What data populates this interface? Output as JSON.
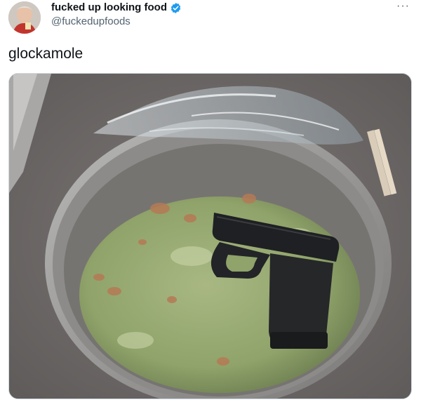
{
  "tweet": {
    "display_name": "fucked up looking food",
    "handle": "@fuckedupfoods",
    "text": "glockamole",
    "more_icon": "more-icon",
    "verified_icon": "verified-badge-icon",
    "colors": {
      "verified": "#1d9bf0",
      "handle": "#536471",
      "text": "#0f1419"
    }
  },
  "media": {
    "description_icon": "photo"
  }
}
